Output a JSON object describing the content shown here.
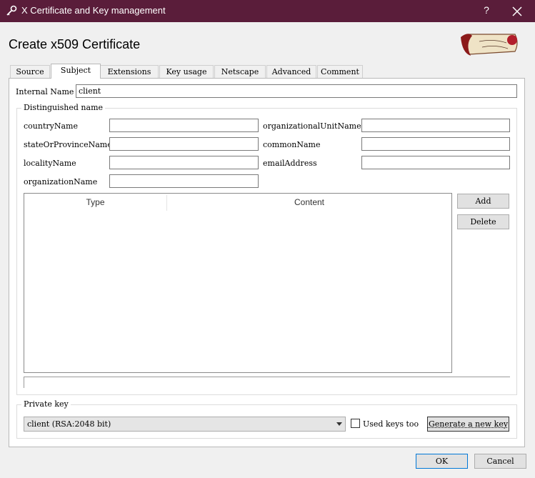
{
  "window": {
    "title": "X Certificate and Key management",
    "help_label": "?",
    "close_icon": "close-icon"
  },
  "header": {
    "title": "Create x509 Certificate"
  },
  "tabs": [
    {
      "label": "Source"
    },
    {
      "label": "Subject"
    },
    {
      "label": "Extensions"
    },
    {
      "label": "Key usage"
    },
    {
      "label": "Netscape"
    },
    {
      "label": "Advanced"
    },
    {
      "label": "Comment"
    }
  ],
  "subject": {
    "internal_name_label": "Internal Name",
    "internal_name_value": "client",
    "dn_group_title": "Distinguished name",
    "fields": {
      "countryName": {
        "label": "countryName",
        "value": ""
      },
      "stateOrProvinceName": {
        "label": "stateOrProvinceName",
        "value": ""
      },
      "localityName": {
        "label": "localityName",
        "value": ""
      },
      "organizationName": {
        "label": "organizationName",
        "value": ""
      },
      "organizationalUnitName": {
        "label": "organizationalUnitName",
        "value": ""
      },
      "commonName": {
        "label": "commonName",
        "value": ""
      },
      "emailAddress": {
        "label": "emailAddress",
        "value": ""
      }
    },
    "table": {
      "columns": [
        "Type",
        "Content"
      ],
      "rows": []
    },
    "add_label": "Add",
    "delete_label": "Delete"
  },
  "private_key": {
    "group_title": "Private key",
    "selected": "client (RSA:2048 bit)",
    "used_keys_label": "Used keys too",
    "used_keys_checked": false,
    "generate_label": "Generate a new key"
  },
  "footer": {
    "ok_label": "OK",
    "cancel_label": "Cancel"
  },
  "colors": {
    "titlebar": "#5a1d3a",
    "default_button_border": "#0078d7"
  }
}
